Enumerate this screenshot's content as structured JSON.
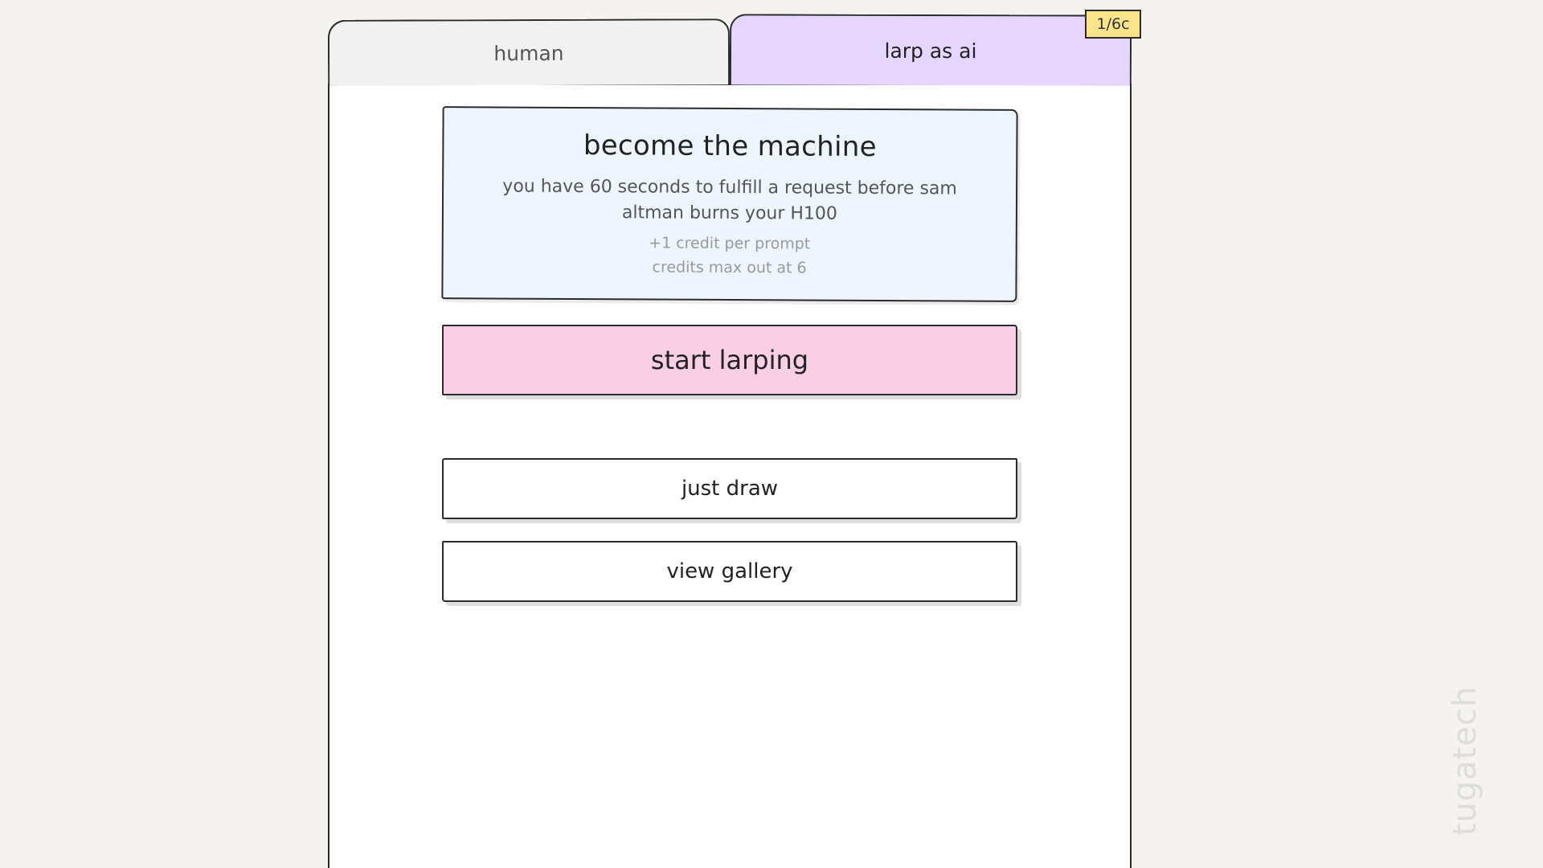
{
  "tabs": {
    "human_label": "human",
    "larp_label": "larp as ai"
  },
  "credit_badge": "1/6c",
  "info_card": {
    "title": "become the machine",
    "description": "you have 60 seconds to fulfill a request before sam altman burns your H100",
    "note_credit": "+1 credit per prompt",
    "note_max": "credits max out at 6"
  },
  "buttons": {
    "start": "start larping",
    "draw": "just draw",
    "gallery": "view gallery"
  },
  "watermark": "tugatech",
  "colors": {
    "background": "#f5f3ef",
    "active_tab": "#e6d6ff",
    "inactive_tab": "#f1f1f1",
    "card": "#eef5ff",
    "start_button": "#f9cfe6",
    "badge": "#fbe48a"
  }
}
